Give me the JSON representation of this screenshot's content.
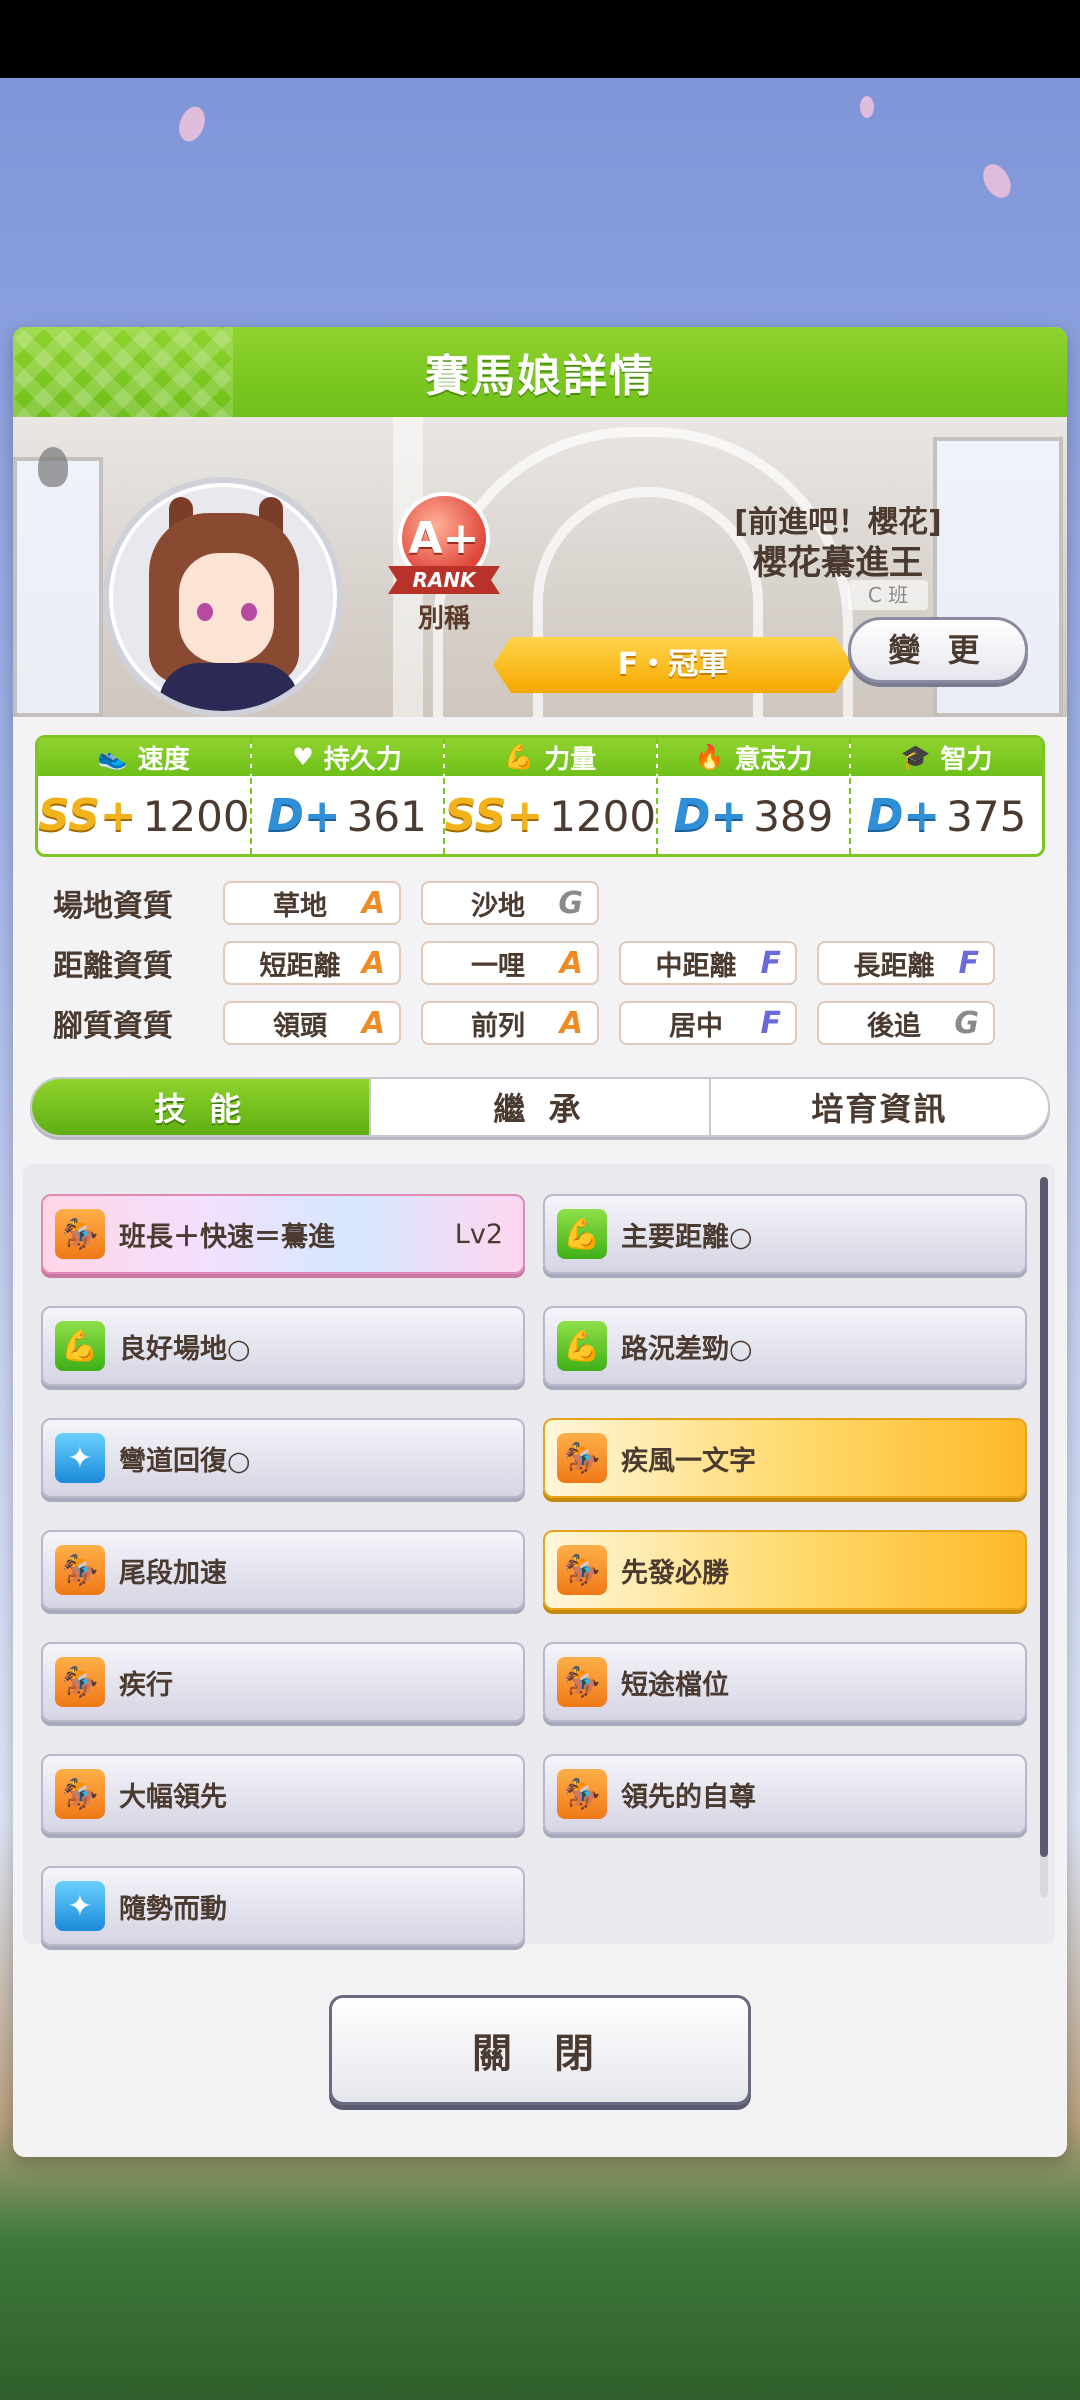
{
  "header": {
    "title": "賽馬娘詳情"
  },
  "profile": {
    "rank_badge": "A+",
    "rank_ribbon": "RANK",
    "rank_sub": "別稱",
    "nickname": "[前進吧！櫻花]",
    "name": "櫻花驀進王",
    "class_tag": "C 班",
    "title_banner": "F・冠軍",
    "change_button": "變 更"
  },
  "stats": [
    {
      "label": "速度",
      "icon": "shoe-icon",
      "grade": "SS+",
      "value": "1200"
    },
    {
      "label": "持久力",
      "icon": "heart-icon",
      "grade": "D+",
      "value": "361"
    },
    {
      "label": "力量",
      "icon": "muscle-icon",
      "grade": "SS+",
      "value": "1200"
    },
    {
      "label": "意志力",
      "icon": "flame-icon",
      "grade": "D+",
      "value": "389"
    },
    {
      "label": "智力",
      "icon": "graduation-cap-icon",
      "grade": "D+",
      "value": "375"
    }
  ],
  "aptitudes": {
    "track": {
      "label": "場地資質",
      "items": [
        {
          "name": "草地",
          "grade": "A"
        },
        {
          "name": "沙地",
          "grade": "G"
        }
      ]
    },
    "distance": {
      "label": "距離資質",
      "items": [
        {
          "name": "短距離",
          "grade": "A"
        },
        {
          "name": "一哩",
          "grade": "A"
        },
        {
          "name": "中距離",
          "grade": "F"
        },
        {
          "name": "長距離",
          "grade": "F"
        }
      ]
    },
    "style": {
      "label": "腳質資質",
      "items": [
        {
          "name": "領頭",
          "grade": "A"
        },
        {
          "name": "前列",
          "grade": "A"
        },
        {
          "name": "居中",
          "grade": "F"
        },
        {
          "name": "後追",
          "grade": "G"
        }
      ]
    }
  },
  "tabs": [
    {
      "label": "技 能",
      "active": true
    },
    {
      "label": "繼 承",
      "active": false
    },
    {
      "label": "培育資訊",
      "active": false
    }
  ],
  "skills": [
    {
      "name": "班長＋快速＝驀進",
      "level": "Lv2",
      "icon": "orange",
      "style": "rainbow"
    },
    {
      "name": "主要距離○",
      "level": "",
      "icon": "green",
      "style": "normal"
    },
    {
      "name": "良好場地○",
      "level": "",
      "icon": "green",
      "style": "normal"
    },
    {
      "name": "路況差勁○",
      "level": "",
      "icon": "green",
      "style": "normal"
    },
    {
      "name": "彎道回復○",
      "level": "",
      "icon": "blue",
      "style": "normal"
    },
    {
      "name": "疾風一文字",
      "level": "",
      "icon": "orange",
      "style": "gold"
    },
    {
      "name": "尾段加速",
      "level": "",
      "icon": "orange",
      "style": "normal"
    },
    {
      "name": "先發必勝",
      "level": "",
      "icon": "orange",
      "style": "gold"
    },
    {
      "name": "疾行",
      "level": "",
      "icon": "orange",
      "style": "normal"
    },
    {
      "name": "短途檔位",
      "level": "",
      "icon": "orange",
      "style": "normal"
    },
    {
      "name": "大幅領先",
      "level": "",
      "icon": "orange",
      "style": "normal"
    },
    {
      "name": "領先的自尊",
      "level": "",
      "icon": "orange",
      "style": "normal"
    },
    {
      "name": "隨勢而動",
      "level": "",
      "icon": "blue",
      "style": "normal"
    }
  ],
  "close_button": "關 閉"
}
